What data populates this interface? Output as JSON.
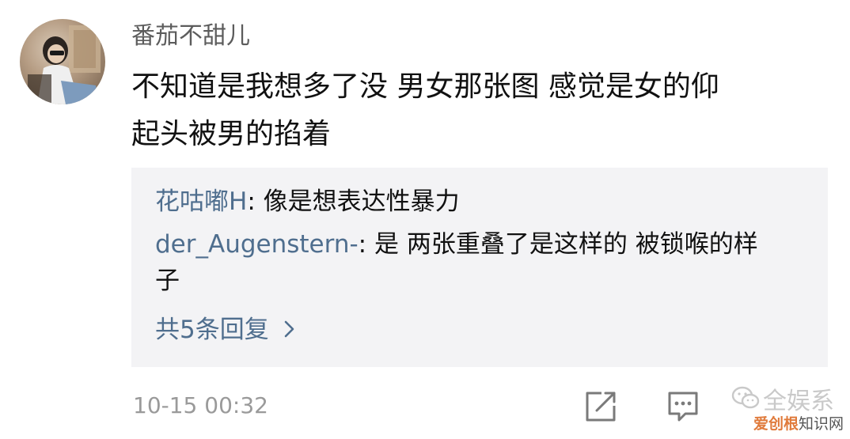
{
  "comment": {
    "username": "番茄不甜儿",
    "text_lines": [
      "不知道是我想多了没 男女那张图 感觉是女的仰",
      "起头被男的掐着"
    ],
    "timestamp": "10-15 00:32"
  },
  "replies": [
    {
      "author": "花咕嘟H",
      "separator": ": ",
      "text": "像是想表达性暴力"
    },
    {
      "author": "der_Augenstern-",
      "separator": ": ",
      "text": "是 两张重叠了是这样的 被锁喉的样",
      "text_cont": "子"
    }
  ],
  "more_replies": {
    "label": "共5条回复",
    "chevron": "›"
  },
  "actions": {
    "share_icon": "share-icon",
    "comment_icon": "comment-icon"
  },
  "watermark": {
    "top": "全娱系",
    "bottom_part1": "爱创根",
    "bottom_part2": "知识网"
  },
  "colors": {
    "link_blue": "#4f6e8e",
    "reply_bg": "#f3f3f5",
    "timestamp_gray": "#9a9a9a",
    "username_gray": "#5c5c5c",
    "watermark_orange": "#e07b3c"
  }
}
